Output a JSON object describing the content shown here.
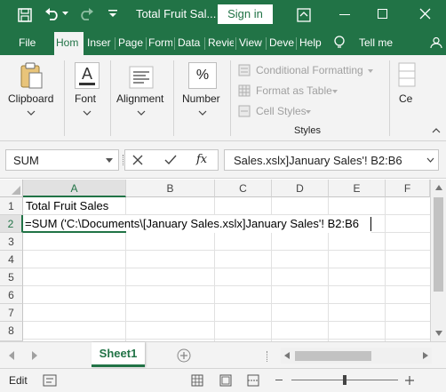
{
  "title_bar": {
    "doc_title": "Total Fruit Sal...",
    "sign_in_label": "Sign in",
    "icons": [
      "save-icon",
      "undo-icon",
      "redo-icon",
      "customize-qat-icon",
      "ribbon-options-icon",
      "minimize-icon",
      "maximize-icon",
      "close-icon"
    ]
  },
  "tabs": [
    {
      "label": "File"
    },
    {
      "label": "Hom"
    },
    {
      "label": "Inser"
    },
    {
      "label": "Page"
    },
    {
      "label": "Form"
    },
    {
      "label": "Data"
    },
    {
      "label": "Revie"
    },
    {
      "label": "View"
    },
    {
      "label": "Deve"
    },
    {
      "label": "Help"
    },
    {
      "label": "Tell me"
    }
  ],
  "ribbon": {
    "clipboard": "Clipboard",
    "font": "Font",
    "alignment": "Alignment",
    "number": "Number",
    "percent_glyph": "%",
    "font_glyph": "A",
    "styles_items": [
      "Conditional Formatting",
      "Format as Table",
      "Cell Styles"
    ],
    "styles_label": "Styles",
    "cells_label": "Ce"
  },
  "formula_bar": {
    "name_box": "SUM",
    "formula": "Sales.xslx]January Sales'! B2:B6",
    "fx": "fx"
  },
  "grid": {
    "columns": [
      "A",
      "B",
      "C",
      "D",
      "E",
      "F"
    ],
    "rows": [
      "1",
      "2",
      "3",
      "4",
      "5",
      "6",
      "7",
      "8"
    ],
    "cells": {
      "A1": "Total Fruit Sales",
      "A2": "=SUM ('C:\\Documents\\[January Sales.xslx]January Sales'! B2:B6"
    }
  },
  "sheets": {
    "active": "Sheet1"
  },
  "status": {
    "mode": "Edit"
  },
  "colors": {
    "accent": "#217346",
    "ribbon_bg": "#f3f3f3"
  }
}
